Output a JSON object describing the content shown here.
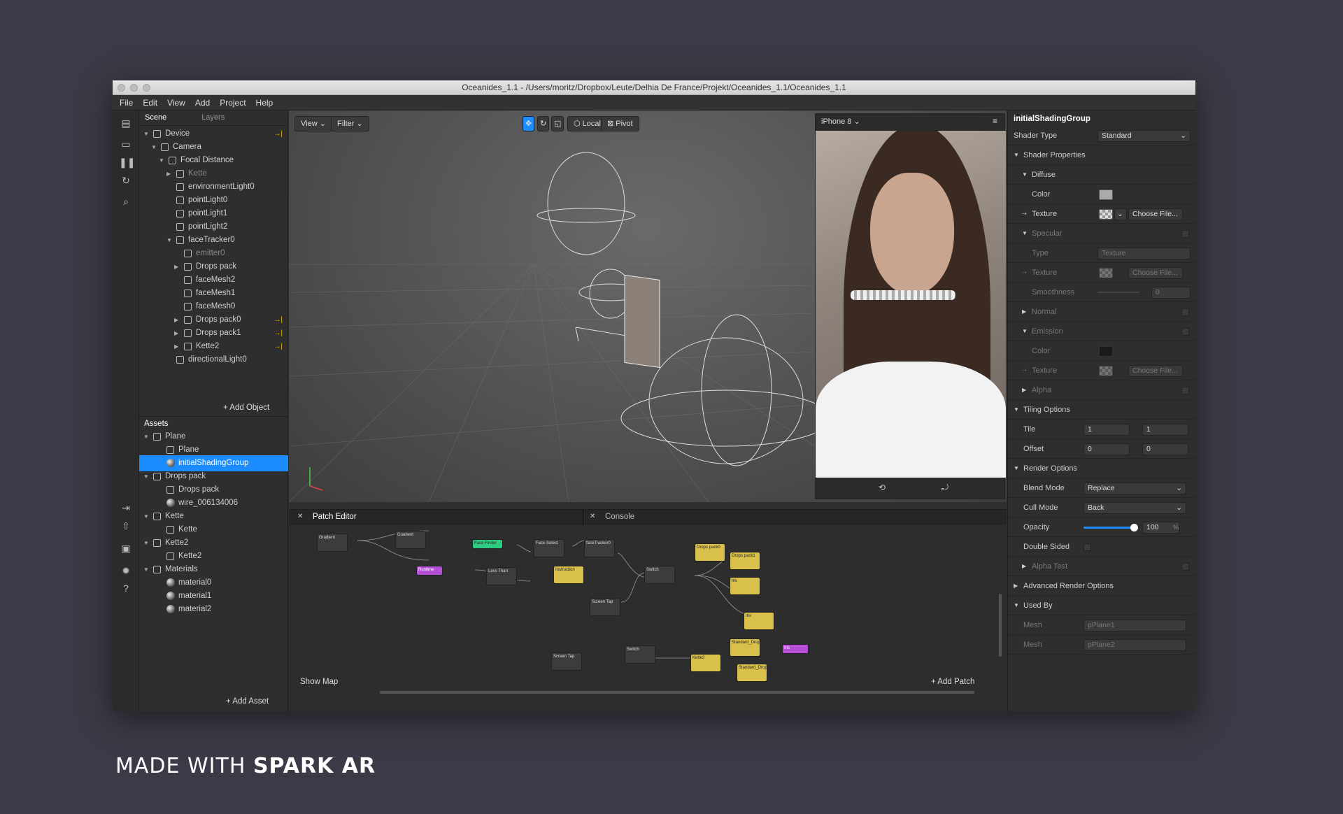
{
  "window": {
    "title": "Oceanides_1.1 - /Users/moritz/Dropbox/Leute/Delhia De France/Projekt/Oceanides_1.1/Oceanides_1.1"
  },
  "menu": [
    "File",
    "Edit",
    "View",
    "Add",
    "Project",
    "Help"
  ],
  "scene_panel": {
    "tabs": [
      "Scene",
      "Layers"
    ],
    "tree": [
      {
        "label": "Device",
        "depth": 0,
        "arrow": "open",
        "pin": true
      },
      {
        "label": "Camera",
        "depth": 1,
        "arrow": "open"
      },
      {
        "label": "Focal Distance",
        "depth": 2,
        "arrow": "open"
      },
      {
        "label": "Kette",
        "depth": 3,
        "arrow": "closed",
        "dim": true
      },
      {
        "label": "environmentLight0",
        "depth": 3
      },
      {
        "label": "pointLight0",
        "depth": 3
      },
      {
        "label": "pointLight1",
        "depth": 3
      },
      {
        "label": "pointLight2",
        "depth": 3
      },
      {
        "label": "faceTracker0",
        "depth": 3,
        "arrow": "open"
      },
      {
        "label": "emitter0",
        "depth": 4,
        "dim": true
      },
      {
        "label": "Drops pack",
        "depth": 4,
        "arrow": "closed"
      },
      {
        "label": "faceMesh2",
        "depth": 4
      },
      {
        "label": "faceMesh1",
        "depth": 4
      },
      {
        "label": "faceMesh0",
        "depth": 4
      },
      {
        "label": "Drops pack0",
        "depth": 4,
        "arrow": "closed",
        "pin": true
      },
      {
        "label": "Drops pack1",
        "depth": 4,
        "arrow": "closed",
        "pin": true
      },
      {
        "label": "Kette2",
        "depth": 4,
        "arrow": "closed",
        "pin": true
      },
      {
        "label": "directionalLight0",
        "depth": 3
      }
    ],
    "add_object": "Add Object"
  },
  "assets_panel": {
    "title": "Assets",
    "tree": [
      {
        "label": "Plane",
        "depth": 0,
        "arrow": "open"
      },
      {
        "label": "Plane",
        "depth": 1
      },
      {
        "label": "initialShadingGroup",
        "depth": 1,
        "selected": true,
        "sphere": true
      },
      {
        "label": "Drops pack",
        "depth": 0,
        "arrow": "open"
      },
      {
        "label": "Drops pack",
        "depth": 1
      },
      {
        "label": "wire_006134006",
        "depth": 1,
        "sphere": true
      },
      {
        "label": "Kette",
        "depth": 0,
        "arrow": "open"
      },
      {
        "label": "Kette",
        "depth": 1
      },
      {
        "label": "Kette2",
        "depth": 0,
        "arrow": "open"
      },
      {
        "label": "Kette2",
        "depth": 1
      },
      {
        "label": "Materials",
        "depth": 0,
        "arrow": "open"
      },
      {
        "label": "material0",
        "depth": 1,
        "sphere": true
      },
      {
        "label": "material1",
        "depth": 1,
        "sphere": true
      },
      {
        "label": "material2",
        "depth": 1,
        "sphere": true
      }
    ],
    "add_asset": "Add Asset"
  },
  "viewport": {
    "view": "View",
    "filter": "Filter",
    "local": "Local",
    "pivot": "Pivot",
    "device": "iPhone 8"
  },
  "patch_editor": {
    "tab": "Patch Editor",
    "console": "Console",
    "show_map": "Show Map",
    "add_patch": "Add Patch",
    "nodes": [
      {
        "label": "Gradient",
        "kind": "grey"
      },
      {
        "label": "Gradient",
        "kind": "grey"
      },
      {
        "label": "Face Finder",
        "kind": "green"
      },
      {
        "label": "Face Select",
        "kind": "grey"
      },
      {
        "label": "faceTracker0",
        "kind": "grey"
      },
      {
        "label": "Runtime",
        "kind": "purple"
      },
      {
        "label": "Less Than",
        "kind": "grey"
      },
      {
        "label": "Instruction",
        "kind": "yellow"
      },
      {
        "label": "Switch",
        "kind": "grey"
      },
      {
        "label": "Screen Tap",
        "kind": "grey"
      },
      {
        "label": "Drops pack0",
        "kind": "yellow"
      },
      {
        "label": "Drops pack1",
        "kind": "yellow"
      },
      {
        "label": "Iris",
        "kind": "yellow"
      },
      {
        "label": "Iris",
        "kind": "yellow"
      },
      {
        "label": "Standard_Drop",
        "kind": "yellow"
      },
      {
        "label": "Iris",
        "kind": "purple"
      },
      {
        "label": "Screen Tap",
        "kind": "grey"
      },
      {
        "label": "Switch",
        "kind": "grey"
      },
      {
        "label": "Kette2",
        "kind": "yellow"
      },
      {
        "label": "Standard_Drop",
        "kind": "yellow"
      }
    ]
  },
  "inspector": {
    "title": "initialShadingGroup",
    "shader_type_label": "Shader Type",
    "shader_type": "Standard",
    "shader_props": "Shader Properties",
    "diffuse": "Diffuse",
    "color": "Color",
    "texture": "Texture",
    "choose_file": "Choose File...",
    "specular": "Specular",
    "type": "Type",
    "type_value": "Texture",
    "smoothness": "Smoothness",
    "smoothness_value": "0",
    "normal": "Normal",
    "emission": "Emission",
    "alpha": "Alpha",
    "tiling": "Tiling Options",
    "tile": "Tile",
    "tile_x": "1",
    "tile_y": "1",
    "offset": "Offset",
    "offset_x": "0",
    "offset_y": "0",
    "render_options": "Render Options",
    "blend_mode_label": "Blend Mode",
    "blend_mode": "Replace",
    "cull_mode_label": "Cull Mode",
    "cull_mode": "Back",
    "opacity_label": "Opacity",
    "opacity": "100",
    "opacity_fraction": 1.0,
    "percent": "%",
    "double_sided": "Double Sided",
    "alpha_test": "Alpha Test",
    "advanced": "Advanced Render Options",
    "used_by": "Used By",
    "mesh": "Mesh",
    "mesh1": "pPlane1",
    "mesh2": "pPlane2"
  },
  "brand": {
    "prefix": "MADE WITH ",
    "name": "SPARK AR"
  },
  "colors": {
    "selection": "#1a8cff",
    "pin": "#e6b800",
    "yellow_node": "#d9c04a",
    "green_node": "#2ecc80",
    "purple_node": "#b44fd6"
  }
}
